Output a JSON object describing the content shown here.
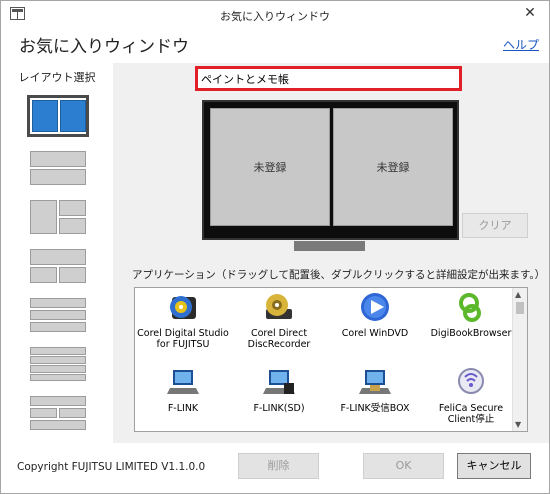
{
  "window": {
    "title": "お気に入りウィンドウ",
    "close_glyph": "✕"
  },
  "header": {
    "title": "お気に入りウィンドウ",
    "help_link": "ヘルプ"
  },
  "sidebar": {
    "label": "レイアウト選択",
    "layouts": [
      {
        "name": "two-vertical",
        "selected": true
      },
      {
        "name": "two-horizontal",
        "selected": false
      },
      {
        "name": "three-left-large",
        "selected": false
      },
      {
        "name": "three-top-large",
        "selected": false
      },
      {
        "name": "three-rows",
        "selected": false
      },
      {
        "name": "four-rows",
        "selected": false
      },
      {
        "name": "four-grid",
        "selected": false
      }
    ]
  },
  "preview": {
    "name_value": "ペイントとメモ帳",
    "slots": [
      "未登録",
      "未登録"
    ],
    "clear_label": "クリア"
  },
  "apps": {
    "instruction": "アプリケーション（ドラッグして配置後、ダブルクリックすると詳細設定が出来ます。）",
    "items": [
      {
        "line1": "Corel Digital Studio",
        "line2": "for FUJITSU",
        "icon": "corel-disc-icon"
      },
      {
        "line1": "Corel Direct",
        "line2": "DiscRecorder",
        "icon": "disc-recorder-icon"
      },
      {
        "line1": "Corel WinDVD",
        "line2": "",
        "icon": "dvd-play-icon"
      },
      {
        "line1": "DigiBookBrowser",
        "line2": "",
        "icon": "digibook-icon"
      },
      {
        "line1": "F-LINK",
        "line2": "",
        "icon": "laptop-icon"
      },
      {
        "line1": "F-LINK(SD)",
        "line2": "",
        "icon": "laptop-sd-icon"
      },
      {
        "line1": "F-LINK受信BOX",
        "line2": "",
        "icon": "laptop-inbox-icon"
      },
      {
        "line1": "FeliCa Secure",
        "line2": "Client停止",
        "icon": "felica-icon"
      }
    ]
  },
  "footer": {
    "copyright": "Copyright FUJITSU LIMITED V1.1.0.0",
    "delete_label": "削除",
    "ok_label": "OK",
    "cancel_label": "キャンセル"
  },
  "colors": {
    "selected_layout": "#2c7fd0",
    "highlight_border": "#e01f26",
    "link": "#1a55c4"
  }
}
